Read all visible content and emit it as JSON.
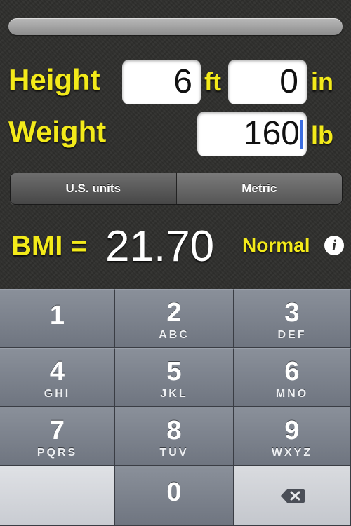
{
  "form": {
    "height_label": "Height",
    "weight_label": "Weight",
    "height_ft_value": "6",
    "height_ft_unit": "ft",
    "height_in_value": "0",
    "height_in_unit": "in",
    "weight_value": "160",
    "weight_unit": "lb"
  },
  "units_segment": {
    "us_label": "U.S. units",
    "metric_label": "Metric"
  },
  "result": {
    "bmi_label": "BMI =",
    "bmi_value": "21.70",
    "category": "Normal",
    "info_icon": "info-icon"
  },
  "keypad": {
    "keys": [
      {
        "num": "1",
        "letters": ""
      },
      {
        "num": "2",
        "letters": "ABC"
      },
      {
        "num": "3",
        "letters": "DEF"
      },
      {
        "num": "4",
        "letters": "GHI"
      },
      {
        "num": "5",
        "letters": "JKL"
      },
      {
        "num": "6",
        "letters": "MNO"
      },
      {
        "num": "7",
        "letters": "PQRS"
      },
      {
        "num": "8",
        "letters": "TUV"
      },
      {
        "num": "9",
        "letters": "WXYZ"
      },
      {
        "num": "0",
        "letters": ""
      }
    ],
    "delete_icon": "backspace-icon"
  },
  "colors": {
    "label_yellow": "#f3ea1a",
    "cursor_blue": "#3b6de0"
  }
}
